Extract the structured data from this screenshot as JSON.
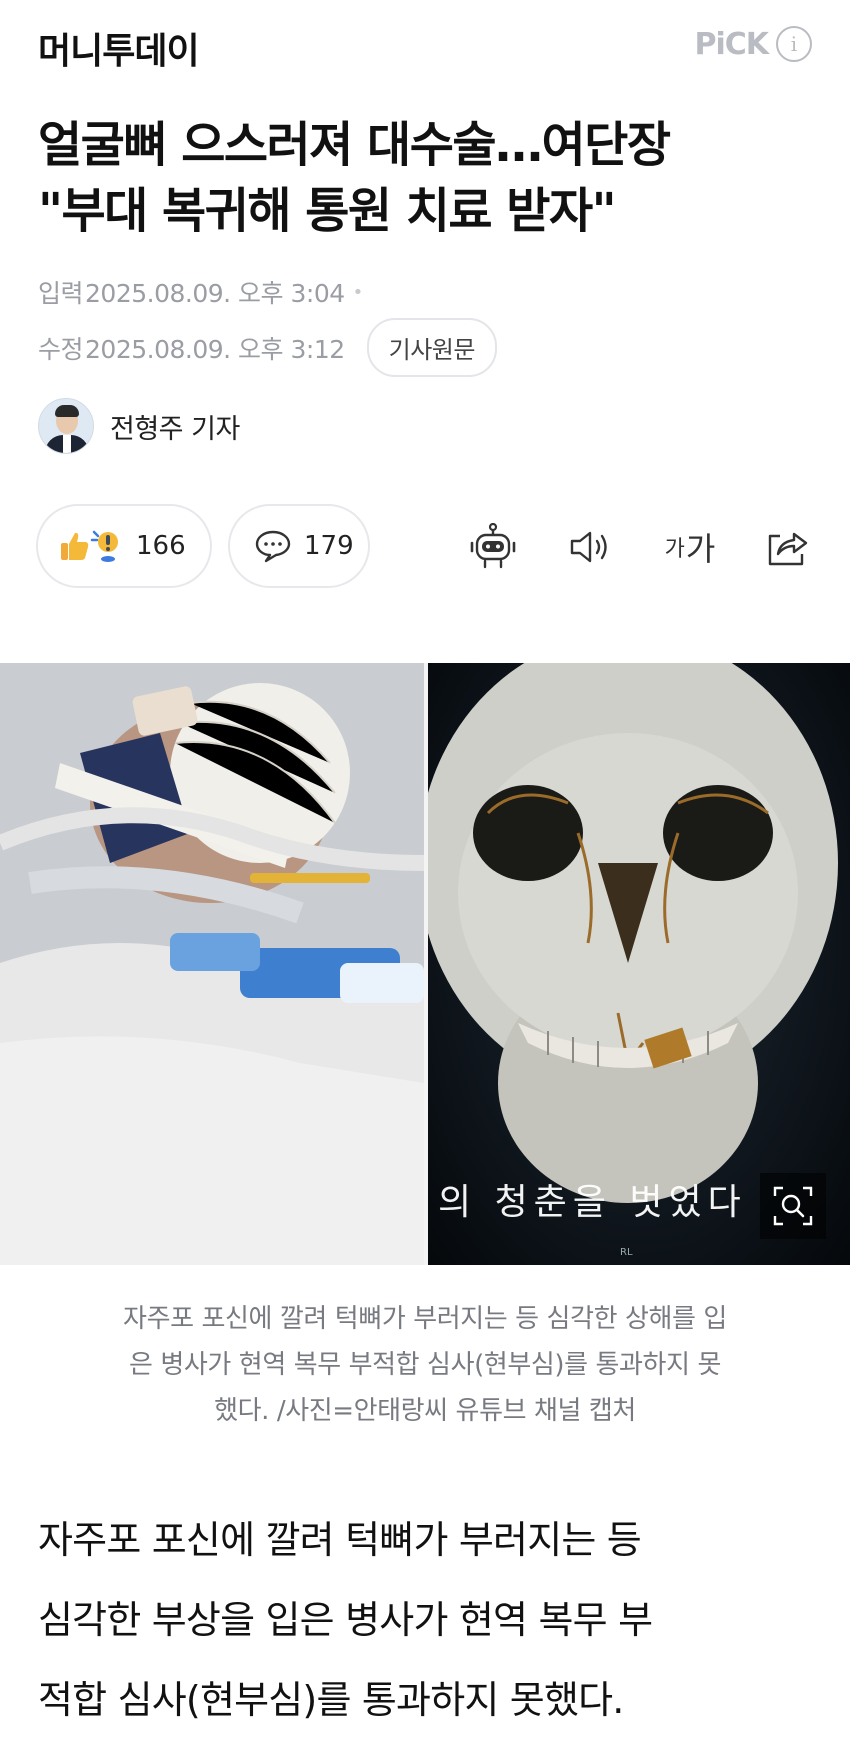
{
  "header": {
    "brand": "머니투데이",
    "pick_label": "PiCK",
    "pick_info_icon": "info-icon"
  },
  "article": {
    "title_lines": [
      "얼굴뼈 으스러져 대수술…여단장",
      "\"부대 복귀해 통원 치료 받자\""
    ],
    "input_label": "입력",
    "input_time": "2025.08.09. 오후 3:04",
    "modified_label": "수정",
    "modified_time": "2025.08.09. 오후 3:12",
    "original_button": "기사원문",
    "author": "전형주 기자",
    "reaction_count": "166",
    "comment_count": "179",
    "font_size_small": "가",
    "font_size_large": "가",
    "photo_overlay_text": "의 청춘을 벗었다",
    "photo_mark": "RL",
    "caption_lines": [
      "자주포 포신에 깔려 턱뼈가 부러지는 등 심각한 상해를 입",
      "은 병사가 현역 복무 부적합 심사(현부심)를 통과하지 못",
      "했다. /사진=안태랑씨 유튜브 채널 캡처"
    ],
    "body_lines": [
      "자주포 포신에 깔려 턱뼈가 부러지는 등",
      "심각한 부상을 입은 병사가 현역 복무 부",
      "적합 심사(현부심)를 통과하지 못했다."
    ]
  },
  "icons": {
    "thumb": "thumbs-up-icon",
    "exclaim": "surprise-icon",
    "comment": "comment-icon",
    "robot": "ai-summary-robot-icon",
    "sound": "speaker-icon",
    "share": "share-icon",
    "zoom": "zoom-icon"
  },
  "colors": {
    "muted": "#9a9da3",
    "pick": "#b9bcc2",
    "caption": "#777a80",
    "reaction_yellow": "#f5b93a",
    "reaction_blue": "#3d7be0"
  }
}
